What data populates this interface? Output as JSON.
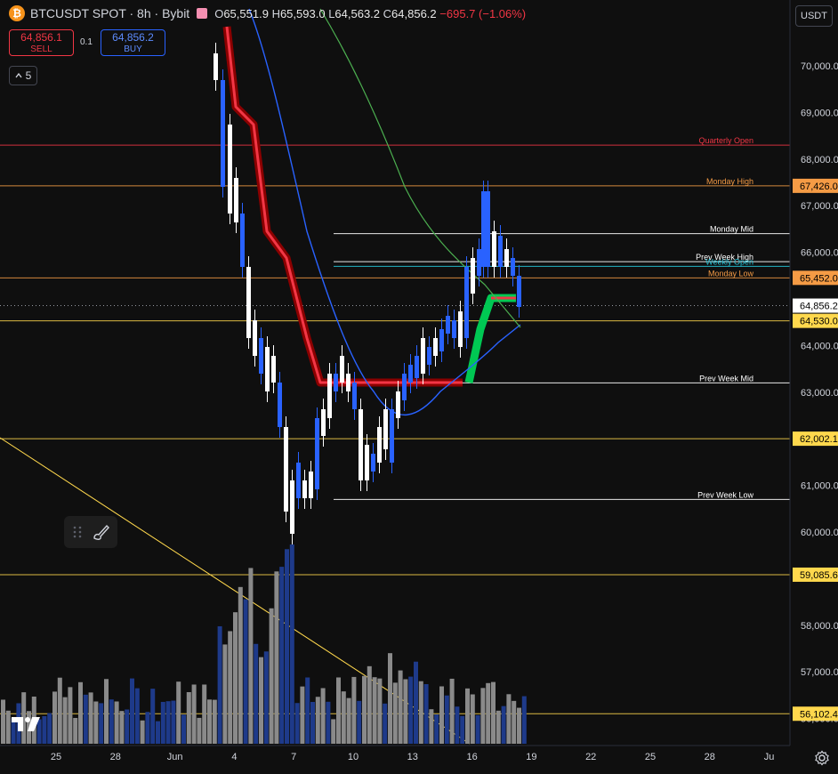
{
  "header": {
    "symbol": "BTCUSDT SPOT · 8h · Bybit",
    "logo_glyph": "₿",
    "open_label": "O",
    "open": "65,551.9",
    "high_label": "H",
    "high": "65,593.0",
    "low_label": "L",
    "low": "64,563.2",
    "close_label": "C",
    "close": "64,856.2",
    "change": "−695.7 (−1.06%)"
  },
  "trade": {
    "sell_price": "64,856.1",
    "sell_label": "SELL",
    "spread": "0.1",
    "buy_price": "64,856.2",
    "buy_label": "BUY"
  },
  "indicators": {
    "count": "5"
  },
  "currency": "USDT",
  "price_axis": {
    "min": 55000,
    "max": 71000,
    "ticks": [
      {
        "value": 70000,
        "label": "70,000.0"
      },
      {
        "value": 69000,
        "label": "69,000.0"
      },
      {
        "value": 68000,
        "label": "68,000.0"
      },
      {
        "value": 67000,
        "label": "67,000.0"
      },
      {
        "value": 66000,
        "label": "66,000.0"
      },
      {
        "value": 64000,
        "label": "64,000.0"
      },
      {
        "value": 63000,
        "label": "63,000.0"
      },
      {
        "value": 61000,
        "label": "61,000.0"
      },
      {
        "value": 60000,
        "label": "60,000.0"
      },
      {
        "value": 58000,
        "label": "58,000.0"
      },
      {
        "value": 57000,
        "label": "57,000.0"
      },
      {
        "value": 56000,
        "label": "56,000.0"
      }
    ],
    "badges": [
      {
        "value": 67426,
        "label": "67,426.0",
        "bg": "#f59b45",
        "fg": "#000000"
      },
      {
        "value": 65452,
        "label": "65,452.0",
        "bg": "#f59b45",
        "fg": "#000000"
      },
      {
        "value": 64856.2,
        "label": "64,856.2",
        "bg": "#ffffff",
        "fg": "#000000"
      },
      {
        "value": 64530,
        "label": "64,530.0",
        "bg": "#ffd84d",
        "fg": "#000000"
      },
      {
        "value": 62002,
        "label": "62,002.1",
        "bg": "#ffd84d",
        "fg": "#000000"
      },
      {
        "value": 59085,
        "label": "59,085.6",
        "bg": "#ffd84d",
        "fg": "#000000"
      },
      {
        "value": 56102,
        "label": "56,102.4",
        "bg": "#ffd84d",
        "fg": "#000000"
      }
    ]
  },
  "time_axis": {
    "labels": [
      "25",
      "28",
      "Jun",
      "4",
      "7",
      "10",
      "13",
      "16",
      "19",
      "22",
      "25",
      "28",
      "Ju"
    ]
  },
  "levels": [
    {
      "value": 68300,
      "label": "Quarterly Open",
      "color": "#f23645",
      "full": true
    },
    {
      "value": 67426,
      "label": "Monday High",
      "color": "#f59b45",
      "full": true
    },
    {
      "value": 66400,
      "label": "Monday Mid",
      "color": "#ffffff",
      "full": false
    },
    {
      "value": 65800,
      "label": "Prev Week High",
      "color": "#ffffff",
      "full": false
    },
    {
      "value": 65700,
      "label": "Weekly Open",
      "color": "#26c6da",
      "full": false
    },
    {
      "value": 65452,
      "label": "Monday Low",
      "color": "#f59b45",
      "full": true
    },
    {
      "value": 64530,
      "label": "",
      "color": "#ffd84d",
      "full": true
    },
    {
      "value": 63200,
      "label": "Prev Week Mid",
      "color": "#ffffff",
      "full": false
    },
    {
      "value": 62002,
      "label": "",
      "color": "#ffd84d",
      "full": true
    },
    {
      "value": 60700,
      "label": "Prev Week Low",
      "color": "#ffffff",
      "full": false
    },
    {
      "value": 59085,
      "label": "",
      "color": "#ffd84d",
      "full": true
    },
    {
      "value": 56102,
      "label": "",
      "color": "#ffd84d",
      "full": true
    }
  ],
  "colors": {
    "up": "#2962ff",
    "down": "#ffffff",
    "vol_up": "#1e3a8a",
    "vol_down": "#8a8a8a",
    "bg": "#0f0f0f",
    "grid": "#1a1a1a",
    "axis_text": "#d1d4dc"
  }
}
